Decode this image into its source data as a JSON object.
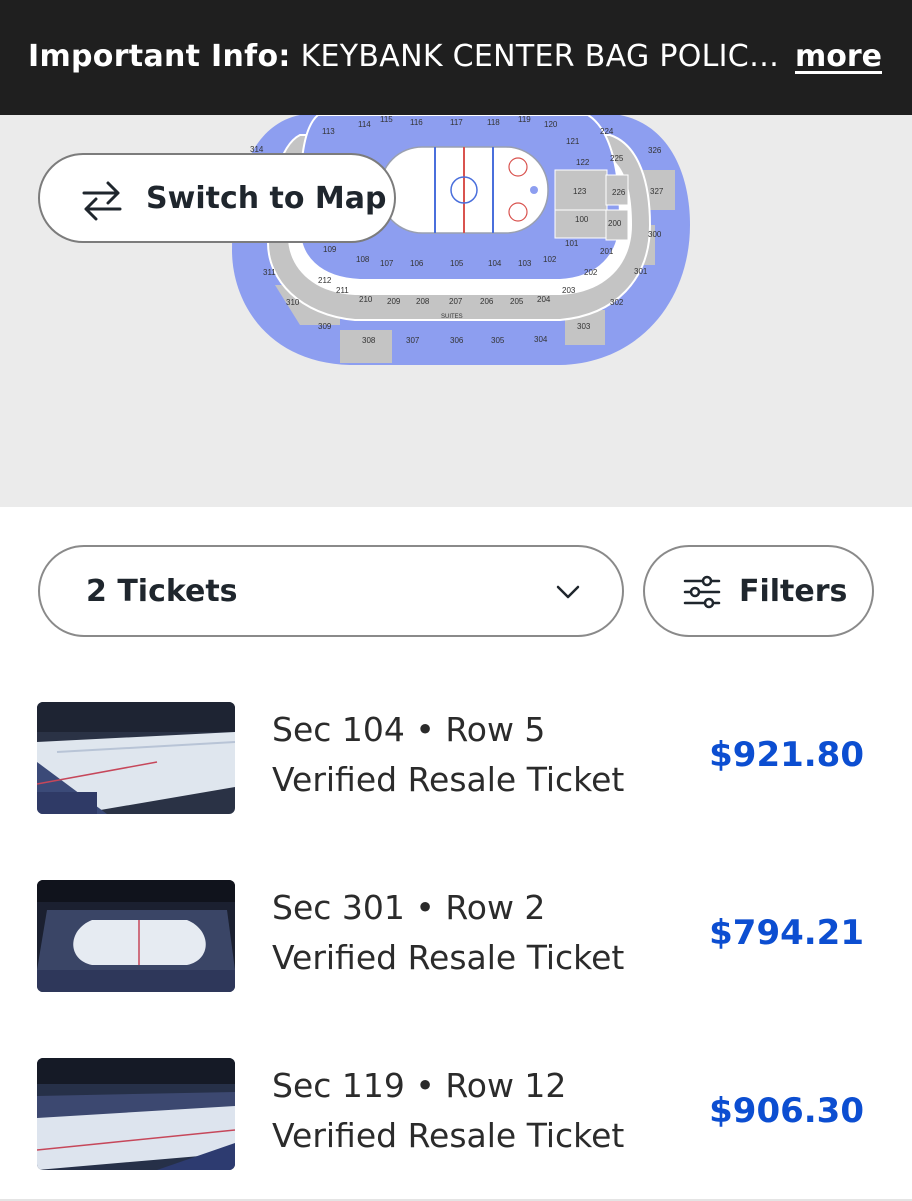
{
  "banner": {
    "label": "Important Info:",
    "message": "KEYBANK CENTER BAG POLIC…",
    "more_link": "more"
  },
  "map": {
    "switch_label": "Switch to Map",
    "colors": {
      "available": "#8d9ef0",
      "unavailable": "#c4c4c4",
      "background": "#ebebeb"
    },
    "section_labels": {
      "top_row": [
        "113",
        "114",
        "115",
        "116",
        "117",
        "118",
        "119",
        "120"
      ],
      "right_inner": [
        "121",
        "122",
        "123",
        "100",
        "101",
        "102"
      ],
      "right_club": [
        "224",
        "225",
        "226",
        "200",
        "201",
        "202",
        "203"
      ],
      "right_upper": [
        "326",
        "327",
        "300",
        "301",
        "302",
        "303"
      ],
      "lower_bottom": [
        "108",
        "107",
        "106",
        "105",
        "104",
        "103"
      ],
      "club_bottom": [
        "211",
        "210",
        "209",
        "208",
        "207",
        "206",
        "205",
        "204"
      ],
      "upper_bottom": [
        "309",
        "308",
        "307",
        "306",
        "305",
        "304"
      ],
      "left": [
        "314",
        "109",
        "311",
        "310",
        "212"
      ],
      "suites": "SUITES",
      "rink_labels": [
        "PENALTY",
        "VISITORS",
        "SABRES"
      ]
    }
  },
  "quantity": {
    "value": "2 Tickets"
  },
  "filters": {
    "label": "Filters"
  },
  "listings": [
    {
      "line1": "Sec 104 • Row 5",
      "line2": "Verified Resale Ticket",
      "price": "$921.80"
    },
    {
      "line1": "Sec 301 • Row 2",
      "line2": "Verified Resale Ticket",
      "price": "$794.21"
    },
    {
      "line1": "Sec 119 • Row 12",
      "line2": "Verified Resale Ticket",
      "price": "$906.30"
    }
  ]
}
